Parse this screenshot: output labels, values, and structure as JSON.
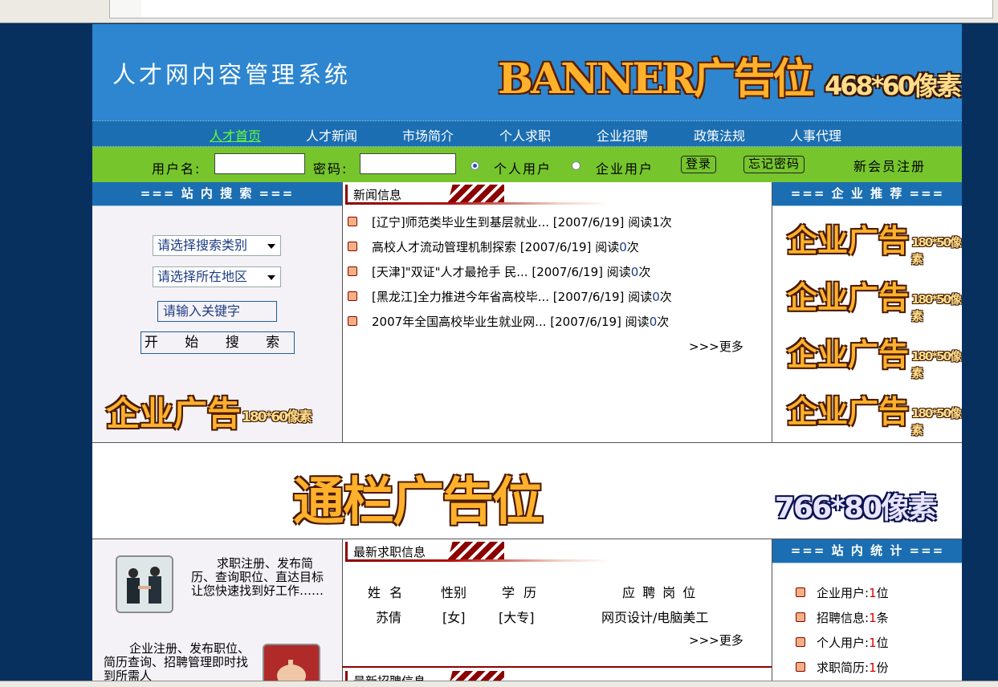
{
  "header": {
    "site_title": "人才网内容管理系统",
    "banner_ad": "BANNER广告位",
    "banner_size": "468*60像素"
  },
  "nav": {
    "items": [
      {
        "label": "人才首页",
        "active": true
      },
      {
        "label": "人才新闻"
      },
      {
        "label": "市场简介"
      },
      {
        "label": "个人求职"
      },
      {
        "label": "企业招聘"
      },
      {
        "label": "政策法规"
      },
      {
        "label": "人事代理"
      }
    ]
  },
  "login": {
    "username_label": "用户名:",
    "password_label": "密码:",
    "radio_personal": "个人用户",
    "radio_company": "企业用户",
    "selected_type": "个人用户",
    "login_button": "登录",
    "forgot_button": "忘记密码",
    "register_link": "新会员注册"
  },
  "search_panel": {
    "title": "=== 站 内 搜 索 ===",
    "category_select": "请选择搜索类别",
    "region_select": "请选择所在地区",
    "keyword_placeholder": "请输入关键字",
    "search_button": "开 始 搜 索",
    "ad_text": "企业广告",
    "ad_size": "180*60像素"
  },
  "news": {
    "title": "新闻信息",
    "items": [
      {
        "title": "[辽宁]师范类毕业生到基层就业...",
        "date": "[2007/6/19]",
        "reads_prefix": "阅读",
        "reads": "1",
        "reads_suffix": "次"
      },
      {
        "title": "高校人才流动管理机制探索",
        "date": "[2007/6/19]",
        "reads_prefix": "阅读",
        "reads": "0",
        "reads_suffix": "次"
      },
      {
        "title": "[天津]\"双证\"人才最抢手 民...",
        "date": "[2007/6/19]",
        "reads_prefix": "阅读",
        "reads": "0",
        "reads_suffix": "次"
      },
      {
        "title": "[黑龙江]全力推进今年省高校毕...",
        "date": "[2007/6/19]",
        "reads_prefix": "阅读",
        "reads": "0",
        "reads_suffix": "次"
      },
      {
        "title": "2007年全国高校毕业生就业网...",
        "date": "[2007/6/19]",
        "reads_prefix": "阅读",
        "reads": "0",
        "reads_suffix": "次"
      }
    ],
    "more": ">>>更多"
  },
  "company_recommend": {
    "title": "=== 企 业 推 荐 ===",
    "ads": [
      {
        "text": "企业广告",
        "size": "180*50像素"
      },
      {
        "text": "企业广告",
        "size": "180*50像素"
      },
      {
        "text": "企业广告",
        "size": "180*50像素"
      },
      {
        "text": "企业广告",
        "size": "180*50像素"
      }
    ]
  },
  "column_ad": {
    "text": "通栏广告位",
    "size": "766*80像素"
  },
  "promo": {
    "jobseeker_text": "求职注册、发布简历、查询职位、直达目标让您快速找到好工作……",
    "employer_text": "企业注册、发布职位、简历查询、招聘管理即时找到所需人"
  },
  "jobseekers": {
    "title": "最新求职信息",
    "headers": [
      "姓 名",
      "性别",
      "学 历",
      "应 聘 岗 位"
    ],
    "rows": [
      {
        "name": "苏倩",
        "gender": "[女]",
        "education": "[大专]",
        "position": "网页设计/电脑美工"
      }
    ],
    "more": ">>>更多"
  },
  "recruit": {
    "title": "最新招聘信息"
  },
  "stats": {
    "title": "=== 站 内 统 计 ===",
    "items": [
      {
        "label": "企业用户:",
        "value": "1",
        "unit": "位"
      },
      {
        "label": "招聘信息:",
        "value": "1",
        "unit": "条"
      },
      {
        "label": "个人用户:",
        "value": "1",
        "unit": "位"
      },
      {
        "label": "求职简历:",
        "value": "1",
        "unit": "份"
      }
    ]
  },
  "colors": {
    "banner_bg": "#2d86cf",
    "nav_bg": "#1b6eb2",
    "login_bar": "#76c52d",
    "outer_bg": "#07305f",
    "accent_red": "#8b0000",
    "nav_active": "#66ff33"
  }
}
